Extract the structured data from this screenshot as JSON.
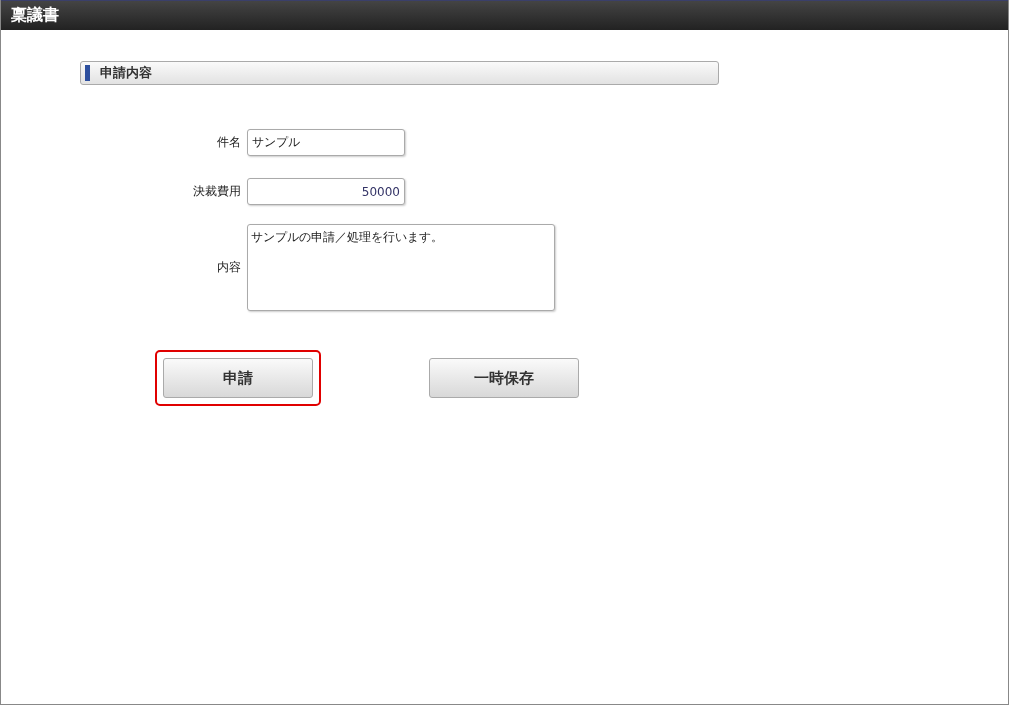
{
  "window": {
    "title": "稟議書"
  },
  "section": {
    "title": "申請内容"
  },
  "fields": [
    {
      "label": "件名",
      "kind": "text",
      "value": "サンプル"
    },
    {
      "label": "決裁費用",
      "kind": "number",
      "value": "50000"
    },
    {
      "label": "内容",
      "kind": "textarea",
      "value": "サンプルの申請／処理を行います。"
    }
  ],
  "buttons": [
    {
      "label": "申請",
      "highlighted": true
    },
    {
      "label": "一時保存",
      "highlighted": false
    }
  ]
}
